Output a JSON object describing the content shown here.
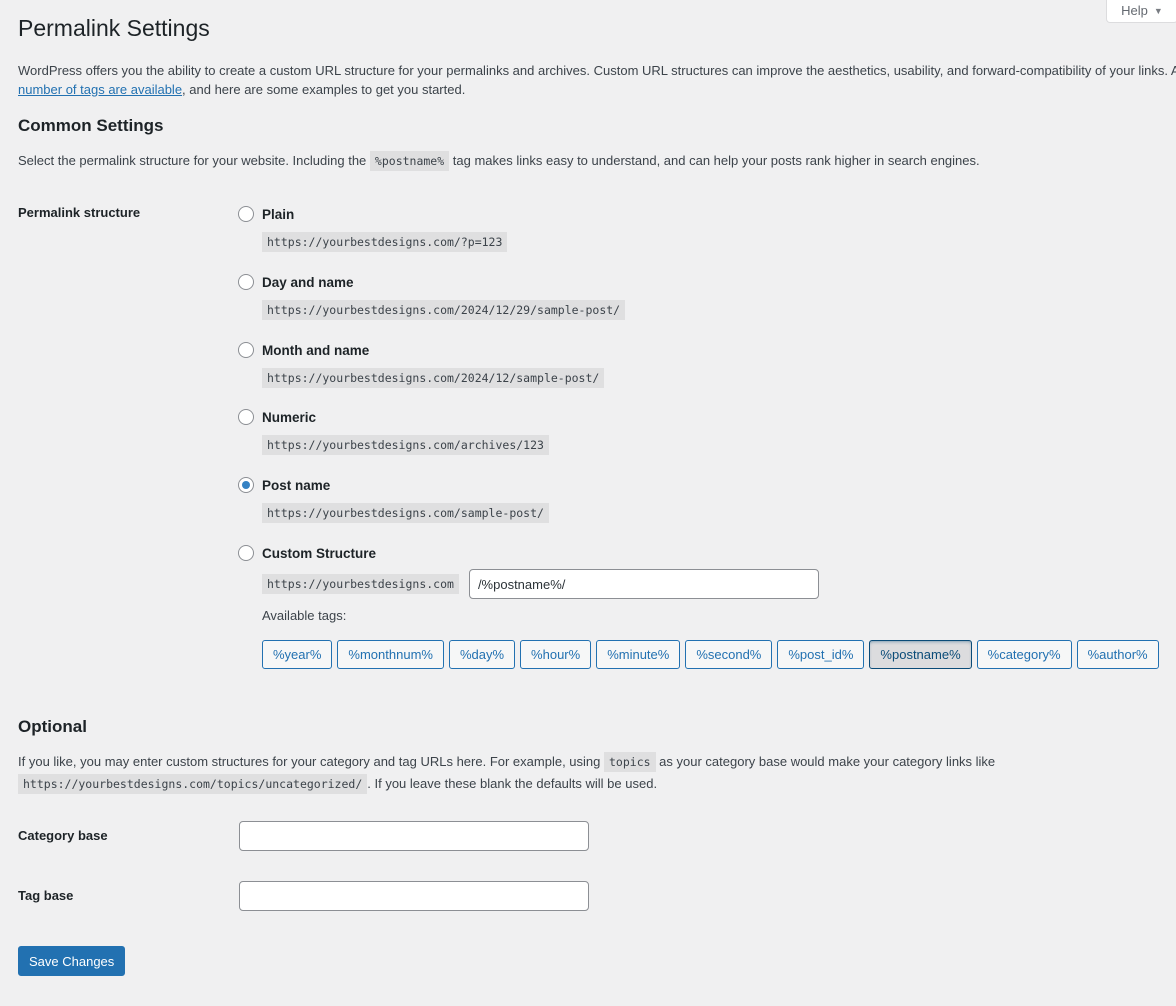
{
  "help_tab": {
    "label": "Help",
    "icon": "caret-down-icon"
  },
  "page_title": "Permalink Settings",
  "intro": {
    "text_before": "WordPress offers you the ability to create a custom URL structure for your permalinks and archives. Custom URL structures can improve the aesthetics, usability, and forward-compatibility of your links. A",
    "link_text": "number of tags are available",
    "text_after": ", and here are some examples to get you started."
  },
  "common": {
    "heading": "Common Settings",
    "desc_before": "Select the permalink structure for your website. Including the",
    "desc_code": "%postname%",
    "desc_after": "tag makes links easy to understand, and can help your posts rank higher in search engines.",
    "structure_label": "Permalink structure",
    "options": [
      {
        "label": "Plain",
        "example": "https://yourbestdesigns.com/?p=123",
        "checked": false
      },
      {
        "label": "Day and name",
        "example": "https://yourbestdesigns.com/2024/12/29/sample-post/",
        "checked": false
      },
      {
        "label": "Month and name",
        "example": "https://yourbestdesigns.com/2024/12/sample-post/",
        "checked": false
      },
      {
        "label": "Numeric",
        "example": "https://yourbestdesigns.com/archives/123",
        "checked": false
      },
      {
        "label": "Post name",
        "example": "https://yourbestdesigns.com/sample-post/",
        "checked": true
      },
      {
        "label": "Custom Structure",
        "checked": false
      }
    ],
    "custom": {
      "base": "https://yourbestdesigns.com",
      "value": "/%postname%/"
    },
    "available_tags_label": "Available tags:",
    "tags": [
      {
        "label": "%year%",
        "active": false
      },
      {
        "label": "%monthnum%",
        "active": false
      },
      {
        "label": "%day%",
        "active": false
      },
      {
        "label": "%hour%",
        "active": false
      },
      {
        "label": "%minute%",
        "active": false
      },
      {
        "label": "%second%",
        "active": false
      },
      {
        "label": "%post_id%",
        "active": false
      },
      {
        "label": "%postname%",
        "active": true
      },
      {
        "label": "%category%",
        "active": false
      },
      {
        "label": "%author%",
        "active": false
      }
    ]
  },
  "optional": {
    "heading": "Optional",
    "desc_before": "If you like, you may enter custom structures for your category and tag URLs here. For example, using",
    "desc_code1": "topics",
    "desc_middle": "as your category base would make your category links like",
    "desc_code2": "https://yourbestdesigns.com/topics/uncategorized/",
    "desc_after": ". If you leave these blank the defaults will be used.",
    "category_base_label": "Category base",
    "category_base_value": "",
    "tag_base_label": "Tag base",
    "tag_base_value": ""
  },
  "save_button": "Save Changes",
  "colors": {
    "accent": "#2271b1",
    "background": "#f0f0f1"
  }
}
